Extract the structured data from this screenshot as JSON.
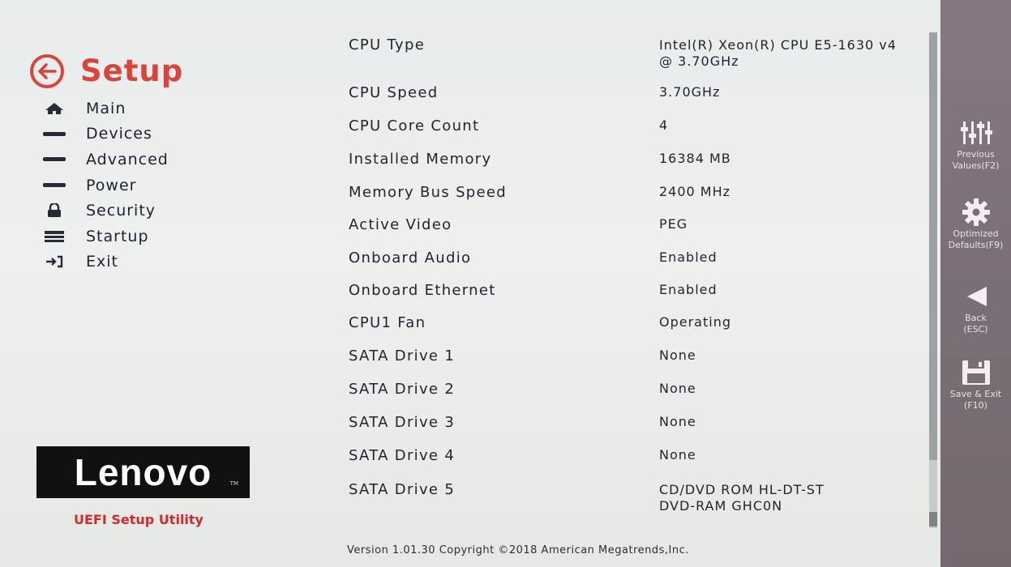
{
  "sidebar": {
    "title": "Setup",
    "items": [
      {
        "label": "Main",
        "icon": "home-icon"
      },
      {
        "label": "Devices",
        "icon": "bar-icon"
      },
      {
        "label": "Advanced",
        "icon": "bar-icon"
      },
      {
        "label": "Power",
        "icon": "bar-icon"
      },
      {
        "label": "Security",
        "icon": "lock-icon"
      },
      {
        "label": "Startup",
        "icon": "stack-icon"
      },
      {
        "label": "Exit",
        "icon": "exit-icon"
      }
    ],
    "logo": "Lenovo",
    "logo_tm": "TM",
    "utility_label": "UEFI Setup Utility"
  },
  "main": {
    "rows": [
      {
        "label": "CPU Type",
        "value": "Intel(R) Xeon(R) CPU E5-1630 v4 @ 3.70GHz"
      },
      {
        "label": "CPU Speed",
        "value": "3.70GHz"
      },
      {
        "label": "CPU Core Count",
        "value": "4"
      },
      {
        "label": "Installed Memory",
        "value": "16384 MB"
      },
      {
        "label": "Memory Bus Speed",
        "value": "2400 MHz"
      },
      {
        "label": "Active Video",
        "value": "PEG"
      },
      {
        "label": "Onboard Audio",
        "value": "Enabled"
      },
      {
        "label": "Onboard Ethernet",
        "value": "Enabled"
      },
      {
        "label": "CPU1 Fan",
        "value": "Operating"
      },
      {
        "label": "SATA Drive 1",
        "value": "None"
      },
      {
        "label": "SATA Drive 2",
        "value": "None"
      },
      {
        "label": "SATA Drive 3",
        "value": "None"
      },
      {
        "label": "SATA Drive 4",
        "value": "None"
      },
      {
        "label": "SATA Drive 5",
        "value": "CD/DVD ROM HL-DT-ST DVD-RAM GHC0N"
      }
    ],
    "version": "Version 1.01.30 Copyright ©2018 American Megatrends,Inc."
  },
  "right_panel": {
    "previous_values": "Previous\nValues(F2)",
    "optimized_defaults": "Optimized\nDefaults(F9)",
    "back": "Back\n(ESC)",
    "save_exit": "Save & Exit\n(F10)"
  },
  "colors": {
    "accent": "#d8453c",
    "panel": "#7b6f77",
    "background": "#eceeed"
  }
}
